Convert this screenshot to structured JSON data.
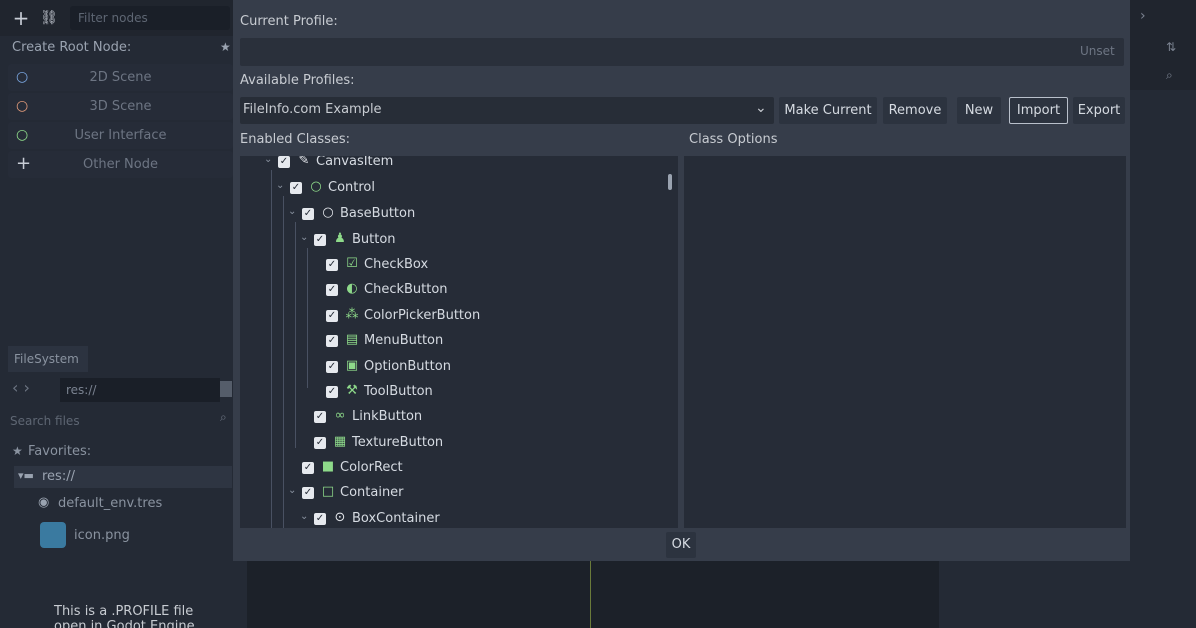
{
  "scene_dock": {
    "filter_placeholder": "Filter nodes",
    "create_root_label": "Create Root Node:",
    "root_items": [
      {
        "label": "2D Scene",
        "icon": "circle-icon",
        "color": "#7aa6e0"
      },
      {
        "label": "3D Scene",
        "icon": "circle-icon",
        "color": "#e09a7a"
      },
      {
        "label": "User Interface",
        "icon": "circle-icon",
        "color": "#8eda8a"
      },
      {
        "label": "Other Node",
        "icon": "plus-icon",
        "color": "#c8cdd6"
      }
    ]
  },
  "filesystem": {
    "tab_label": "FileSystem",
    "path": "res://",
    "search_placeholder": "Search files",
    "favorites_label": "Favorites:",
    "res_label": "res://",
    "files": [
      "default_env.tres",
      "icon.png"
    ]
  },
  "caption": {
    "line1": "This is a .PROFILE file",
    "line2": "open in Godot Engine"
  },
  "dialog": {
    "current_profile_label": "Current Profile:",
    "unset_label": "Unset",
    "available_profiles_label": "Available Profiles:",
    "selected_profile": "FileInfo.com Example",
    "buttons": {
      "make_current": "Make Current",
      "remove": "Remove",
      "new": "New",
      "import": "Import",
      "export": "Export"
    },
    "enabled_classes_label": "Enabled Classes:",
    "class_options_label": "Class Options",
    "ok_label": "OK",
    "tree": [
      {
        "label": "CanvasItem",
        "icon": "pencil-icon",
        "expanded": true,
        "checked": true
      },
      {
        "label": "Control",
        "icon": "control-icon",
        "expanded": true,
        "checked": true
      },
      {
        "label": "BaseButton",
        "icon": "base-button-icon",
        "expanded": true,
        "checked": true
      },
      {
        "label": "Button",
        "icon": "button-icon",
        "expanded": true,
        "checked": true
      },
      {
        "label": "CheckBox",
        "icon": "checkbox-icon",
        "checked": true
      },
      {
        "label": "CheckButton",
        "icon": "toggle-icon",
        "checked": true
      },
      {
        "label": "ColorPickerButton",
        "icon": "color-picker-icon",
        "checked": true
      },
      {
        "label": "MenuButton",
        "icon": "menu-button-icon",
        "checked": true
      },
      {
        "label": "OptionButton",
        "icon": "option-button-icon",
        "checked": true
      },
      {
        "label": "ToolButton",
        "icon": "tool-button-icon",
        "checked": true
      },
      {
        "label": "LinkButton",
        "icon": "link-icon",
        "checked": true
      },
      {
        "label": "TextureButton",
        "icon": "texture-button-icon",
        "checked": true
      },
      {
        "label": "ColorRect",
        "icon": "color-rect-icon",
        "checked": true
      },
      {
        "label": "Container",
        "icon": "container-icon",
        "expanded": true,
        "checked": true
      },
      {
        "label": "BoxContainer",
        "icon": "box-container-icon",
        "expanded": true,
        "checked": true
      }
    ]
  },
  "colors": {
    "dialog_bg": "#363d4a",
    "panel_bg": "#262c37",
    "accent_green": "#8eda8a",
    "text": "#d6dbe2"
  }
}
